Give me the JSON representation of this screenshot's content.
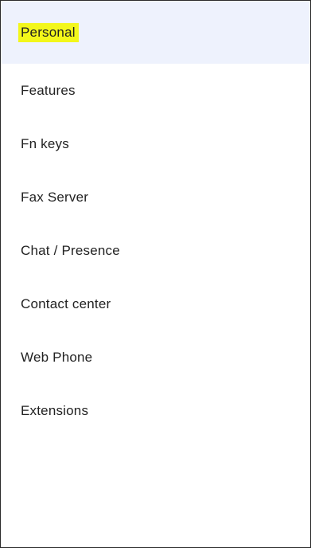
{
  "sidebar": {
    "items": [
      {
        "label": "Personal",
        "active": true
      },
      {
        "label": "Features"
      },
      {
        "label": "Fn keys"
      },
      {
        "label": "Fax Server"
      },
      {
        "label": "Chat / Presence"
      },
      {
        "label": "Contact center"
      },
      {
        "label": "Web Phone"
      },
      {
        "label": "Extensions"
      }
    ],
    "colors": {
      "active_background": "#eef2fd",
      "highlight": "#f3f71a",
      "text": "#222222",
      "border": "#2b2b2b"
    }
  }
}
